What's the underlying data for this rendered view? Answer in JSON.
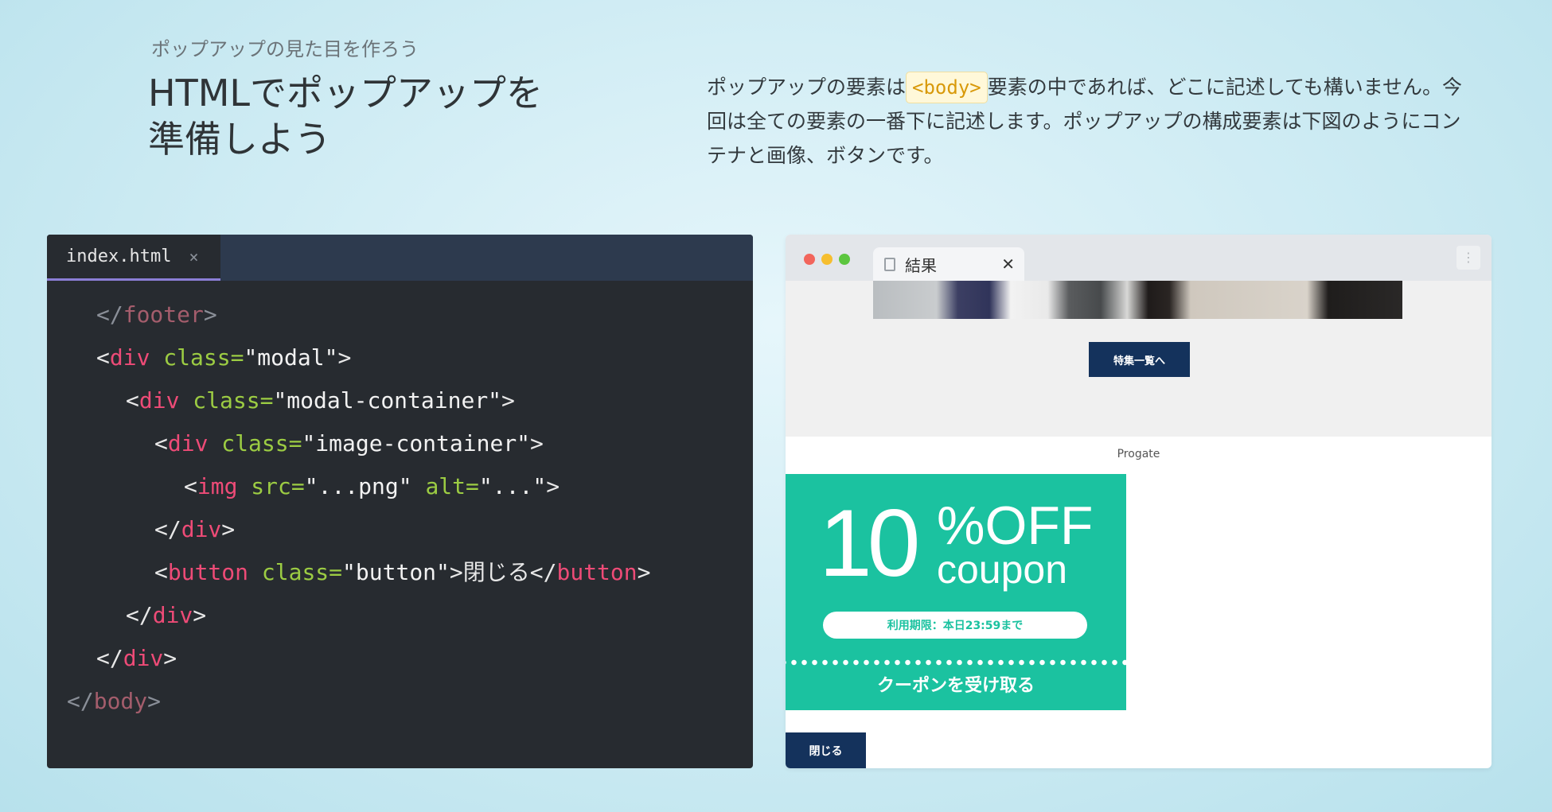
{
  "header": {
    "eyebrow": "ポップアップの見た目を作ろう",
    "title_line1": "HTMLでポップアップを",
    "title_line2": "準備しよう"
  },
  "description": {
    "part1": "ポップアップの要素は",
    "code": "<body>",
    "part2": "要素の中であれば、どこに記述しても構いません。今回は全ての要素の一番下に記述します。ポップアップの構成要素は下図のようにコンテナと画像、ボタンです。"
  },
  "editor": {
    "tab_name": "index.html",
    "tab_close": "×",
    "lines": {
      "l1": {
        "open": "</",
        "tag": "footer",
        "close": ">"
      },
      "l2": {
        "open": "<",
        "tag": "div",
        "sp": " ",
        "attr": "class=",
        "val": "\"modal\"",
        "close": ">"
      },
      "l3": {
        "open": "<",
        "tag": "div",
        "sp": " ",
        "attr": "class=",
        "val": "\"modal-container\"",
        "close": ">"
      },
      "l4": {
        "open": "<",
        "tag": "div",
        "sp": " ",
        "attr": "class=",
        "val": "\"image-container\"",
        "close": ">"
      },
      "l5": {
        "open": "<",
        "tag": "img",
        "sp": " ",
        "attr1": "src=",
        "val1": "\"...png\"",
        "sp2": " ",
        "attr2": "alt=",
        "val2": "\"...\"",
        "close": ">"
      },
      "l6": {
        "open": "</",
        "tag": "div",
        "close": ">"
      },
      "l7": {
        "open": "<",
        "tag": "button",
        "sp": " ",
        "attr": "class=",
        "val": "\"button\"",
        "gt": ">",
        "text": "閉じる",
        "open2": "</",
        "tag2": "button",
        "close": ">"
      },
      "l8": {
        "open": "</",
        "tag": "div",
        "close": ">"
      },
      "l9": {
        "open": "</",
        "tag": "div",
        "close": ">"
      },
      "l10": {
        "open": "</",
        "tag": "body",
        "close": ">"
      }
    }
  },
  "browser": {
    "tab_label": "結果",
    "tab_close": "✕",
    "menu": "⋮",
    "feature_button": "特集一覧へ",
    "site_name": "Progate",
    "coupon": {
      "number": "10",
      "off": "%OFF",
      "word": "coupon",
      "expiry": "利用期限：本日23:59まで",
      "receive": "クーポンを受け取る"
    },
    "close_button": "閉じる"
  },
  "colors": {
    "tag": "#ee4b77",
    "attr": "#9ccc43",
    "coupon_green": "#1bc2a0",
    "navy_button": "#14325c"
  }
}
